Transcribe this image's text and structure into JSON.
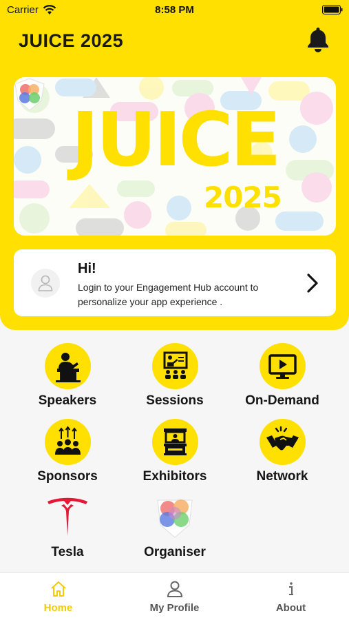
{
  "status_bar": {
    "carrier": "Carrier",
    "time": "8:58 PM"
  },
  "app": {
    "title": "JUICE 2025"
  },
  "banner": {
    "word": "JUICE",
    "year": "2025"
  },
  "login_card": {
    "greeting": "Hi!",
    "message": "Login to your Engagement Hub account to personalize your app experience ."
  },
  "tiles": [
    {
      "label": "Speakers",
      "icon": "speaker-podium-icon"
    },
    {
      "label": "Sessions",
      "icon": "presentation-audience-icon"
    },
    {
      "label": "On-Demand",
      "icon": "video-play-icon"
    },
    {
      "label": "Sponsors",
      "icon": "group-arrows-up-icon"
    },
    {
      "label": "Exhibitors",
      "icon": "exhibition-booth-icon"
    },
    {
      "label": "Network",
      "icon": "handshake-icon"
    },
    {
      "label": "Tesla",
      "icon": "tesla-logo"
    },
    {
      "label": "Organiser",
      "icon": "organiser-logo"
    }
  ],
  "tab_bar": {
    "tabs": [
      {
        "label": "Home",
        "icon": "home-icon",
        "active": true
      },
      {
        "label": "My Profile",
        "icon": "person-icon",
        "active": false
      },
      {
        "label": "About",
        "icon": "info-icon",
        "active": false
      }
    ]
  },
  "colors": {
    "brand_yellow": "#ffe000",
    "active_tab": "#f2cc00",
    "tesla_red": "#e31937"
  }
}
